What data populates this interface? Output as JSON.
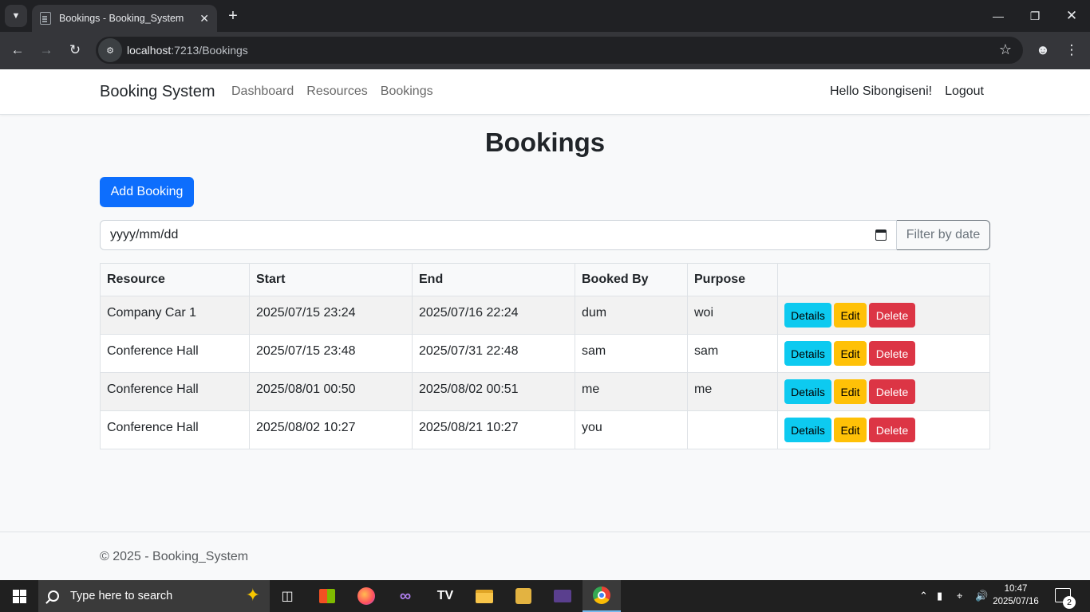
{
  "browser": {
    "tab_title": "Bookings - Booking_System",
    "url_host": "localhost",
    "url_path": ":7213/Bookings"
  },
  "navbar": {
    "brand": "Booking System",
    "links": [
      "Dashboard",
      "Resources",
      "Bookings"
    ],
    "greeting": "Hello Sibongiseni!",
    "logout": "Logout"
  },
  "page": {
    "title": "Bookings",
    "add_button": "Add Booking",
    "date_placeholder": "yyyy/mm/dd",
    "filter_button": "Filter by date"
  },
  "table": {
    "headers": [
      "Resource",
      "Start",
      "End",
      "Booked By",
      "Purpose",
      ""
    ],
    "rows": [
      {
        "resource": "Company Car 1",
        "start": "2025/07/15 23:24",
        "end": "2025/07/16 22:24",
        "booked_by": "dum",
        "purpose": "woi"
      },
      {
        "resource": "Conference Hall",
        "start": "2025/07/15 23:48",
        "end": "2025/07/31 22:48",
        "booked_by": "sam",
        "purpose": "sam"
      },
      {
        "resource": "Conference Hall",
        "start": "2025/08/01 00:50",
        "end": "2025/08/02 00:51",
        "booked_by": "me",
        "purpose": "me"
      },
      {
        "resource": "Conference Hall",
        "start": "2025/08/02 10:27",
        "end": "2025/08/21 10:27",
        "booked_by": "you",
        "purpose": ""
      }
    ],
    "actions": {
      "details": "Details",
      "edit": "Edit",
      "delete": "Delete"
    },
    "action_colors": {
      "details": "#0dcaf0",
      "edit": "#ffc107",
      "delete": "#dc3545"
    }
  },
  "footer": {
    "text": "© 2025 - Booking_System"
  },
  "taskbar": {
    "search_placeholder": "Type here to search",
    "time": "10:47",
    "date": "2025/07/16",
    "notification_count": "2"
  },
  "colors": {
    "primary": "#0d6efd",
    "chrome_dark": "#202124"
  }
}
